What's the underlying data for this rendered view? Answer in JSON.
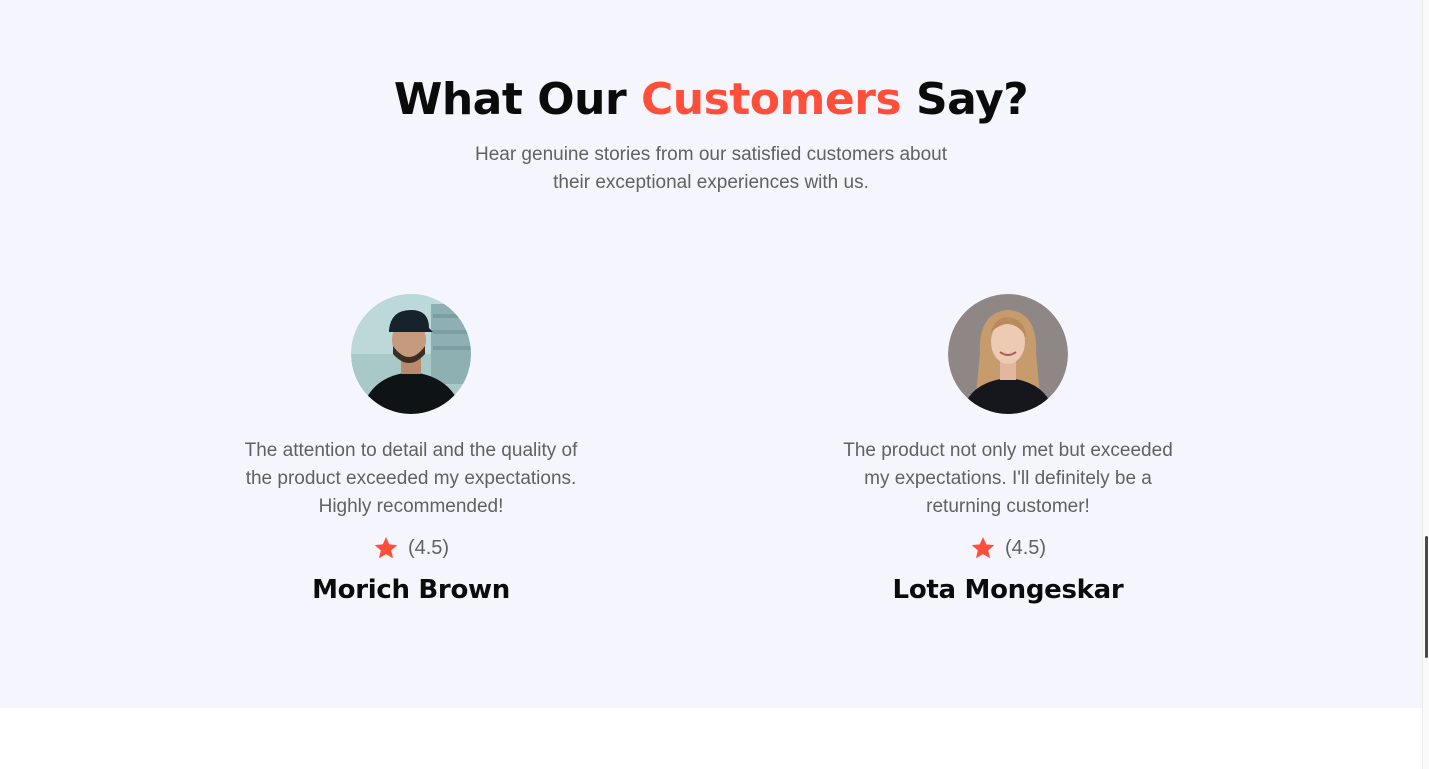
{
  "section": {
    "title_before": "What Our",
    "title_accent": "Customers",
    "title_after": "Say?",
    "subtitle_line1": "Hear genuine stories from our satisfied customers about",
    "subtitle_line2": "their exceptional experiences with us."
  },
  "colors": {
    "accent": "#ff4f3b",
    "section_background": "#f5f5fd",
    "body_text": "#616161",
    "heading_text": "#0b0b0b"
  },
  "testimonials": [
    {
      "quote_line1": "The attention to detail and the quality of",
      "quote_line2": "the product exceeded my expectations.",
      "quote_line3": "Highly recommended!",
      "rating": "(4.5)",
      "name": "Morich Brown",
      "icon": "star-icon"
    },
    {
      "quote_line1": "The product not only met but exceeded",
      "quote_line2": "my expectations. I'll definitely be a",
      "quote_line3": "returning customer!",
      "rating": "(4.5)",
      "name": "Lota Mongeskar",
      "icon": "star-icon"
    }
  ]
}
